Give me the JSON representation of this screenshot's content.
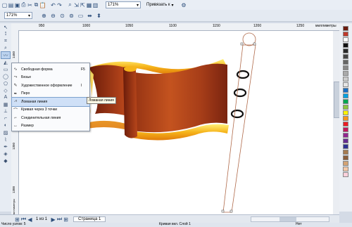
{
  "toolbar": {
    "zoom_top": "171%",
    "snap_label": "Привязать к",
    "zoom_left": "171%"
  },
  "ruler": {
    "unit": "миллиметры",
    "h_ticks": [
      "950",
      "1000",
      "1050",
      "1100",
      "1150",
      "1200",
      "1250"
    ],
    "v_ticks": [
      "1450",
      "1400",
      "1350",
      "1300"
    ],
    "v_unit": "миллиметры"
  },
  "flyout": {
    "items": [
      {
        "label": "Свободная форма",
        "shortcut": "F5",
        "icon": "freehand-icon"
      },
      {
        "label": "Безье",
        "shortcut": "",
        "icon": "bezier-icon"
      },
      {
        "label": "Художественное оформление",
        "shortcut": "I",
        "icon": "artistic-media-icon"
      },
      {
        "label": "Перо",
        "shortcut": "",
        "icon": "pen-icon"
      },
      {
        "label": "Ломаная линия",
        "shortcut": "",
        "icon": "polyline-icon"
      },
      {
        "label": "Кривая через 3 точки",
        "shortcut": "",
        "icon": "three-point-curve-icon"
      },
      {
        "label": "Соединительная линия",
        "shortcut": "",
        "icon": "connector-icon"
      },
      {
        "label": "Размер",
        "shortcut": "",
        "icon": "dimension-icon"
      }
    ],
    "tooltip": "Ломаная линия"
  },
  "pages": {
    "counter": "1 из 1",
    "tab": "Страница 1"
  },
  "status": {
    "left": "Число узлов: 5",
    "middle": "Кривая вкл. Слой 1",
    "right": "Нет"
  },
  "palette_colors": [
    "#6b1a0e",
    "#c0392b",
    "#ffffff",
    "#111111",
    "#2a2a2a",
    "#444444",
    "#666666",
    "#888888",
    "#aaaaaa",
    "#cccccc",
    "#e5e5e5",
    "#1a6fc4",
    "#00a0e0",
    "#00a651",
    "#8dc63f",
    "#fff200",
    "#f7941d",
    "#ed1c24",
    "#c2185b",
    "#92278f",
    "#662d91",
    "#2e3192",
    "#a67c52",
    "#8b5e3c",
    "#d4a373",
    "#f4c9a8",
    "#ffd1dc"
  ]
}
